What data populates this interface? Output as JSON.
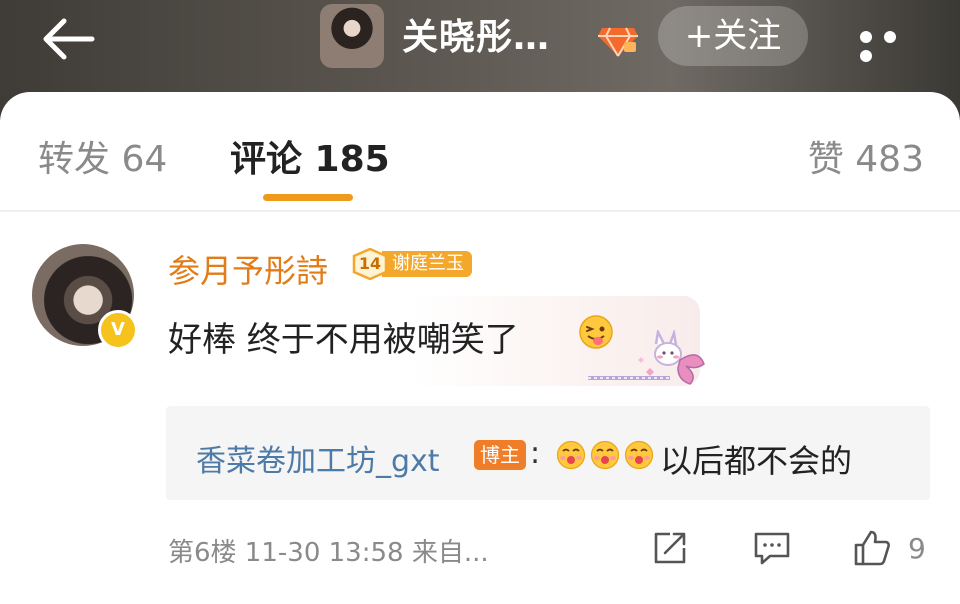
{
  "header": {
    "back_icon": "arrow-left-icon",
    "title": "关晓彤…",
    "vip_icon": "diamond-icon",
    "follow_label": "+关注",
    "more_icon": "more-dots-icon"
  },
  "tabs": [
    {
      "label": "转发 64",
      "active": false
    },
    {
      "label": "评论 185",
      "active": true
    },
    {
      "label": "赞 483",
      "active": false
    }
  ],
  "comment": {
    "username": "参月予彤詩",
    "verified_icon": "v-badge-icon",
    "fan_badge": {
      "level": "14",
      "name": "谢庭兰玉"
    },
    "text": "好棒 终于不用被嘲笑了",
    "emoji": "tongue-wink-emoji",
    "reply": {
      "username": "香菜卷加工坊_gxt",
      "tag": "博主",
      "colon": ":",
      "emojis": [
        "kiss-emoji",
        "kiss-emoji",
        "kiss-emoji"
      ],
      "text": "以后都不会的"
    },
    "meta": "第6楼 11-30 13:58 来自...",
    "actions": {
      "share_icon": "share-icon",
      "reply_icon": "comment-icon",
      "like_icon": "thumb-up-icon",
      "like_count": "9"
    }
  },
  "colors": {
    "accent": "#f09a1c",
    "username": "#e27c18",
    "reply_name": "#4d7aa6",
    "poster_tag": "#f07d27"
  }
}
